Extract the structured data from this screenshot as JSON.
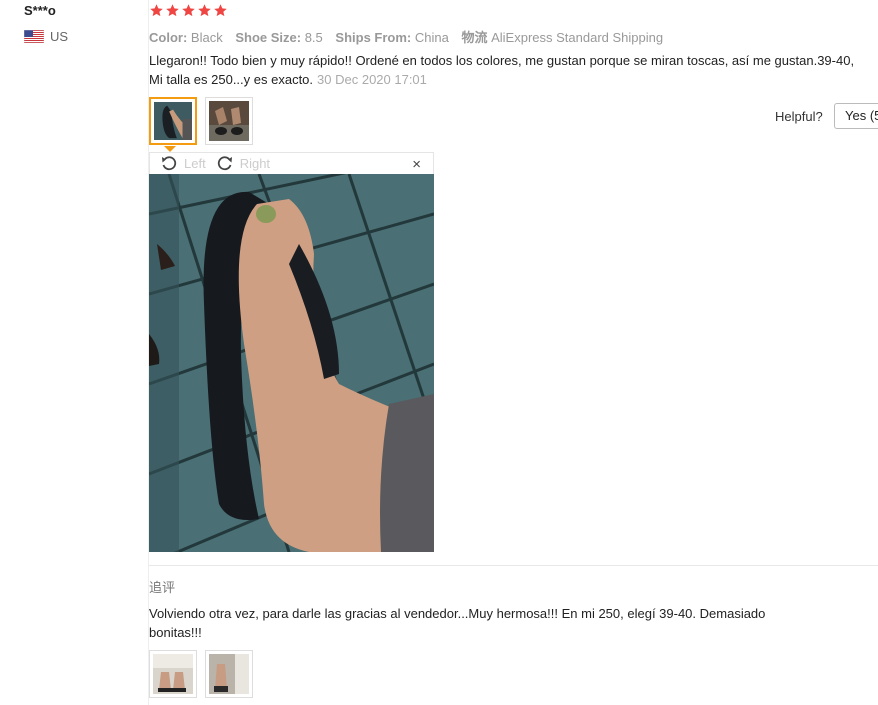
{
  "reviewer": {
    "name": "S***o",
    "country": "US"
  },
  "rating": {
    "value": 5,
    "max": 5,
    "color": "#f04643"
  },
  "attributes": [
    {
      "key": "Color:",
      "value": "Black"
    },
    {
      "key": "Shoe Size:",
      "value": "8.5"
    },
    {
      "key": "Ships From:",
      "value": "China"
    },
    {
      "key": "物流",
      "value": "AliExpress Standard Shipping"
    }
  ],
  "review": {
    "text": "Llegaron!! Todo bien y muy rápido!! Ordené en todos los colores, me gustan porque se miran toscas, así me gustan.39-40, Mi talla es 250...y es exacto.",
    "date": "30 Dec 2020 17:01"
  },
  "helpful": {
    "label": "Helpful?",
    "yes_label": "Yes (5"
  },
  "viewer": {
    "left_label": "Left",
    "right_label": "Right",
    "close_label": "×"
  },
  "followup": {
    "title": "追评",
    "text": "Volviendo otra vez, para darle las gracias al vendedor...Muy hermosa!!! En mi 250, elegí 39-40. Demasiado bonitas!!!"
  },
  "colors": {
    "accent": "#f39c12",
    "star": "#f04643"
  }
}
